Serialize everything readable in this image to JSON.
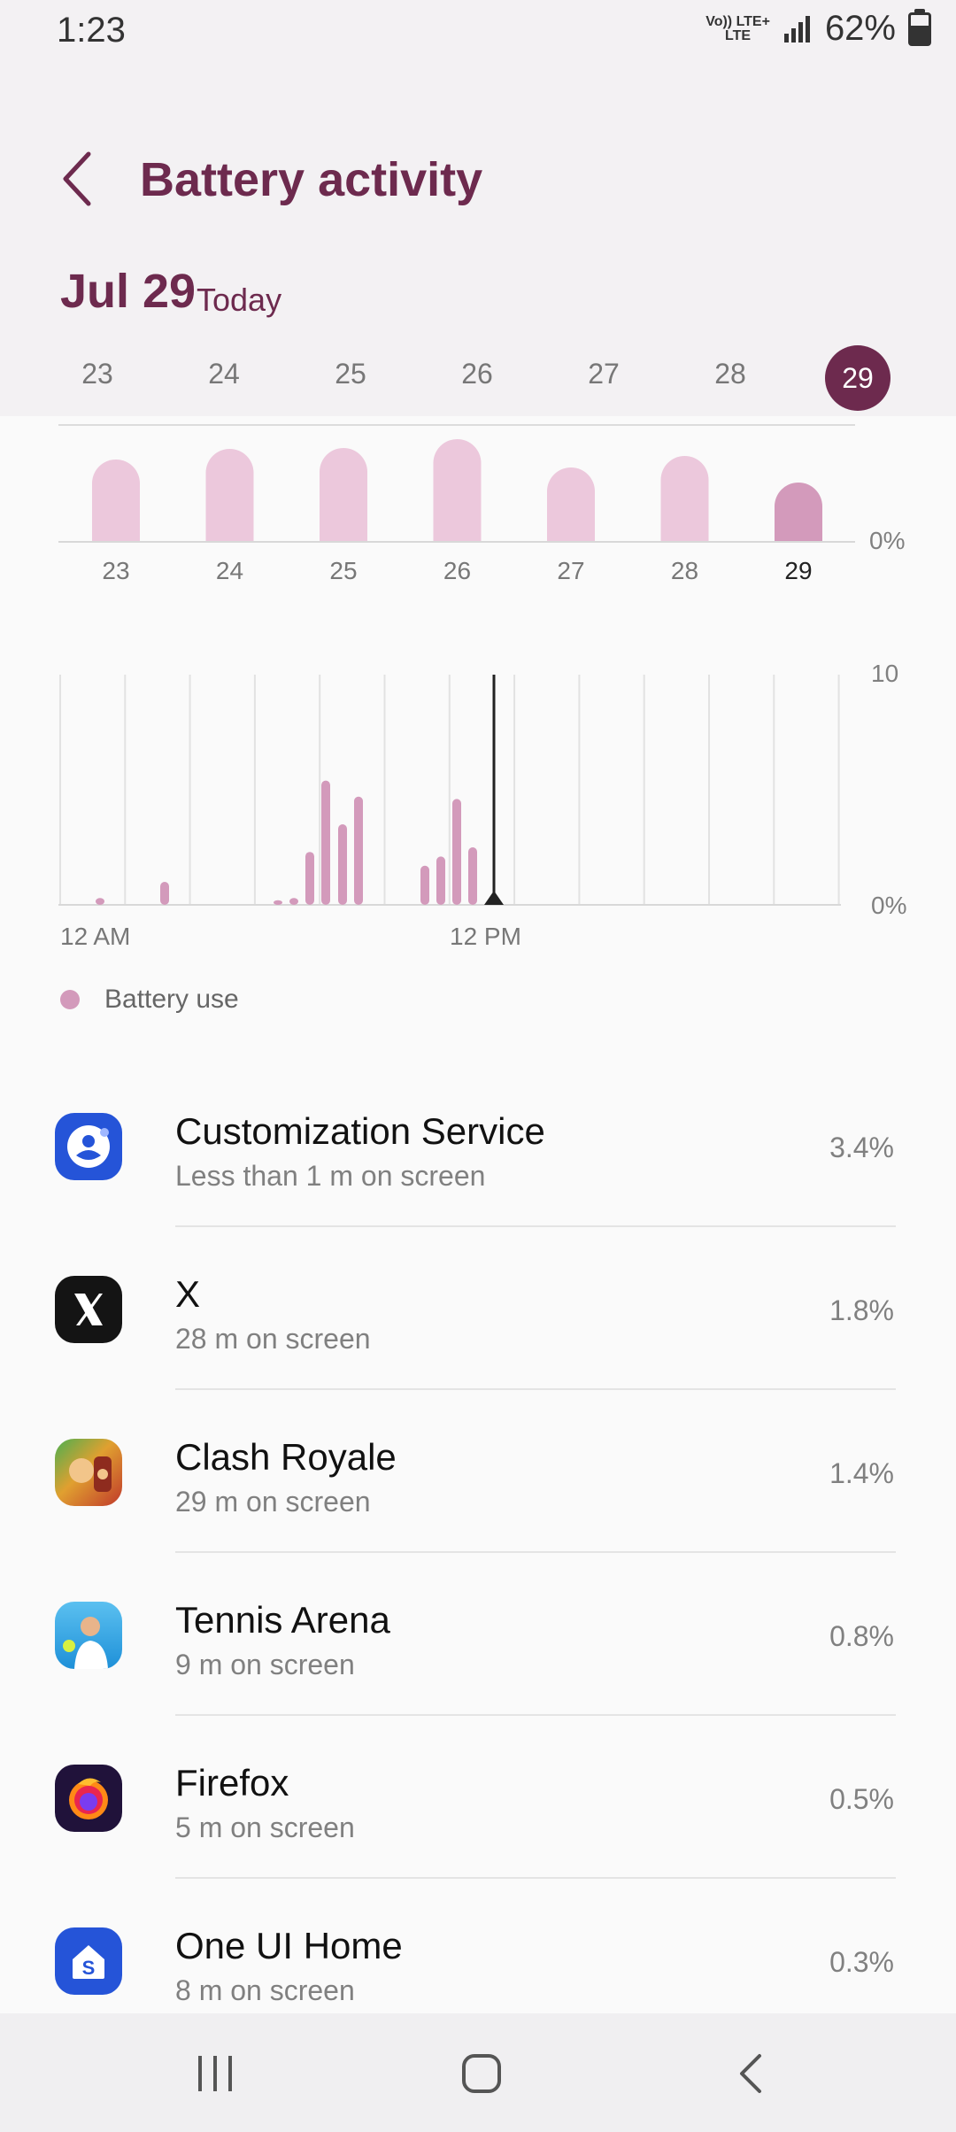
{
  "status_bar": {
    "time": "1:23",
    "network_top": "Vo)) LTE+",
    "network_bottom": "LTE",
    "battery_text": "62%"
  },
  "header": {
    "back_icon": "chevron-left-icon",
    "title": "Battery activity"
  },
  "date": {
    "label": "Jul 29",
    "sub": "Today"
  },
  "week": {
    "days": [
      "23",
      "24",
      "25",
      "26",
      "27",
      "28"
    ],
    "selected": "29"
  },
  "chart_data": [
    {
      "type": "bar",
      "categories": [
        "23",
        "24",
        "25",
        "26",
        "27",
        "28",
        "29"
      ],
      "values": [
        93,
        105,
        106,
        116,
        84,
        97,
        67
      ],
      "ylabel": "",
      "tick_labels": {
        "y_bottom": "0%"
      },
      "highlight": "29"
    },
    {
      "type": "bar",
      "x_labels": {
        "start": "12 AM",
        "mid": "12 PM"
      },
      "y_labels": {
        "top": "10",
        "bottom": "0%"
      },
      "ylim": [
        0,
        10
      ],
      "values": [
        0.3,
        1.0,
        1.1,
        0.2,
        0.2,
        0.2,
        0.3,
        0.8,
        2.3,
        5.4,
        3.5,
        4.7,
        1.7,
        2.1,
        4.6,
        2.5
      ],
      "series_name": "Battery use",
      "color": "#d39abb"
    }
  ],
  "legend": {
    "label": "Battery use"
  },
  "apps": [
    {
      "name": "Customization Service",
      "sub": "Less than 1 m on screen",
      "pct": "3.4%",
      "icon": "customization-service-icon"
    },
    {
      "name": "X",
      "sub": "28 m on screen",
      "pct": "1.8%",
      "icon": "x-app-icon"
    },
    {
      "name": "Clash Royale",
      "sub": "29 m on screen",
      "pct": "1.4%",
      "icon": "clash-royale-icon"
    },
    {
      "name": "Tennis Arena",
      "sub": "9 m on screen",
      "pct": "0.8%",
      "icon": "tennis-arena-icon"
    },
    {
      "name": "Firefox",
      "sub": "5 m on screen",
      "pct": "0.5%",
      "icon": "firefox-icon"
    },
    {
      "name": "One UI Home",
      "sub": "8 m on screen",
      "pct": "0.3%",
      "icon": "one-ui-home-icon"
    }
  ],
  "colors": {
    "accent": "#6d2a4e",
    "bar_light": "#ecc8dc",
    "bar_highlight": "#d39abb"
  }
}
